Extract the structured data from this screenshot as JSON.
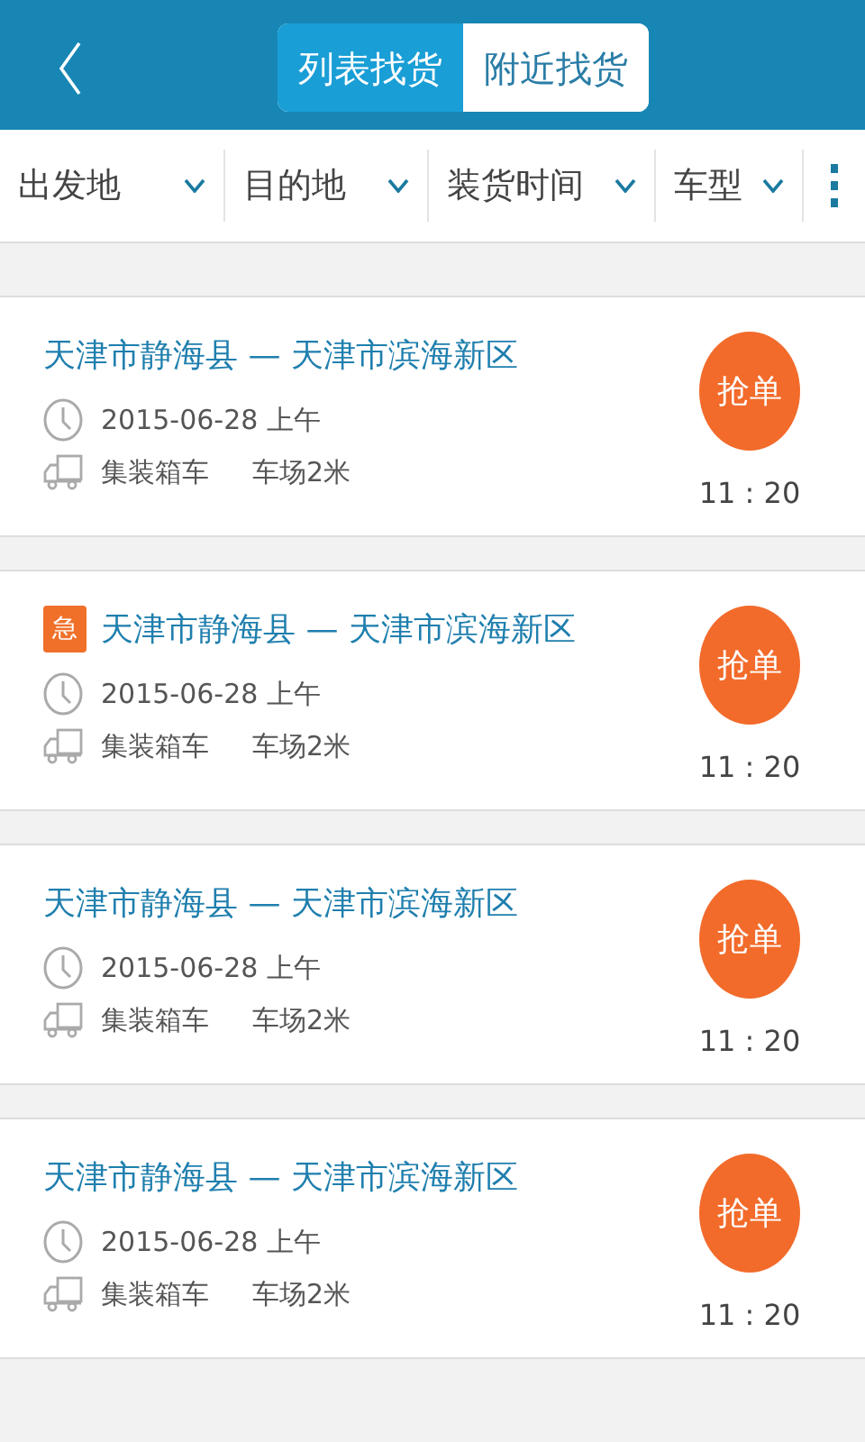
{
  "header": {
    "tabs": [
      {
        "label": "列表找货",
        "selected": true
      },
      {
        "label": "附近找货",
        "selected": false
      }
    ]
  },
  "filters": [
    {
      "label": "出发地"
    },
    {
      "label": "目的地"
    },
    {
      "label": "装货时间"
    },
    {
      "label": "车型"
    }
  ],
  "orders": [
    {
      "urgent": false,
      "route": "天津市静海县 — 天津市滨海新区",
      "date": "2015-06-28 上午",
      "vehicle": "集装箱车",
      "length": "车场2米",
      "action": "抢单",
      "time": "11 : 20"
    },
    {
      "urgent": true,
      "urgent_label": "急",
      "route": "天津市静海县 — 天津市滨海新区",
      "date": "2015-06-28 上午",
      "vehicle": "集装箱车",
      "length": "车场2米",
      "action": "抢单",
      "time": "11 : 20"
    },
    {
      "urgent": false,
      "route": "天津市静海县 — 天津市滨海新区",
      "date": "2015-06-28 上午",
      "vehicle": "集装箱车",
      "length": "车场2米",
      "action": "抢单",
      "time": "11 : 20"
    },
    {
      "urgent": false,
      "route": "天津市静海县 — 天津市滨海新区",
      "date": "2015-06-28 上午",
      "vehicle": "集装箱车",
      "length": "车场2米",
      "action": "抢单",
      "time": "11 : 20"
    }
  ]
}
